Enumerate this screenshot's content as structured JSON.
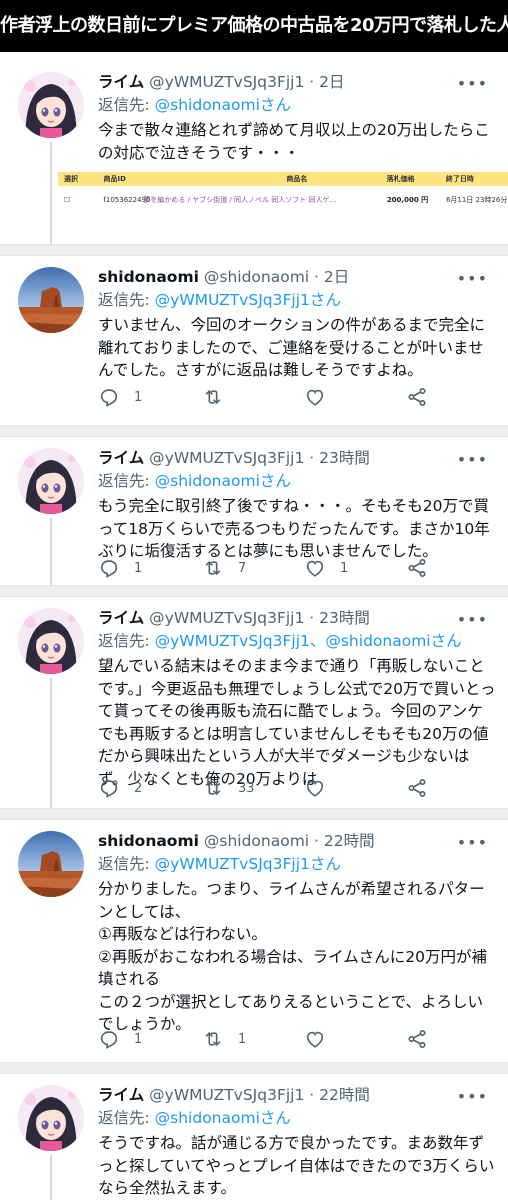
{
  "banner": "作者浮上の数日前にプレミア価格の中古品を20万円で落札した人",
  "reply_prefix": "返信先: ",
  "tweets": [
    {
      "name": "ライム",
      "handle": "@yWMUZTvSJq3Fjj1",
      "time": "2日",
      "reply_to": "@shidonaomi",
      "reply_suffix": "さん",
      "text": "今まで散々連絡とれず諦めて月収以上の20万出したらこの対応で泣きそうです・・・",
      "avatar": "anime-girl"
    },
    {
      "name": "shidonaomi",
      "handle": "@shidonaomi",
      "time": "2日",
      "reply_to": "@yWMUZTvSJq3Fjj1",
      "reply_suffix": "さん",
      "text": "すいません、今回のオークションの件があるまで完全に離れておりましたので、ご連絡を受けることが叶いませんでした。さすがに返品は難しそうですよね。",
      "avatar": "desert-rock",
      "replies": "1",
      "retweets": "",
      "likes": ""
    },
    {
      "name": "ライム",
      "handle": "@yWMUZTvSJq3Fjj1",
      "time": "23時間",
      "reply_to": "@shidonaomi",
      "reply_suffix": "さん",
      "text": "もう完全に取引終了後ですね・・・。そもそも20万で買って18万くらいで売るつもりだったんです。まさか10年ぶりに垢復活するとは夢にも思いませんでした。",
      "avatar": "anime-girl",
      "replies": "1",
      "retweets": "7",
      "likes": "1"
    },
    {
      "name": "ライム",
      "handle": "@yWMUZTvSJq3Fjj1",
      "time": "23時間",
      "reply_to": "@yWMUZTvSJq3Fjj1、@shidonaomi",
      "reply_suffix": "さん",
      "text": "望んでいる結末はそのまま今まで通り「再販しないことです。」今更返品も無理でしょうし公式で20万で買いとって貰ってその後再販も流石に酷でしょう。今回のアンケでも再販するとは明言していませんしそもそも20万の値だから興味出たという人が大半でダメージも少ないはず。少なくとも俺の20万よりは",
      "avatar": "anime-girl",
      "replies": "2",
      "retweets": "33",
      "likes": ""
    },
    {
      "name": "shidonaomi",
      "handle": "@shidonaomi",
      "time": "22時間",
      "reply_to": "@yWMUZTvSJq3Fjj1",
      "reply_suffix": "さん",
      "text": "分かりました。つまり、ライムさんが希望されるパターンとしては、\n①再販などは行わない。\n②再販がおこなわれる場合は、ライムさんに20万円が補填される\nこの２つが選択としてありえるということで、よろしいでしょうか。",
      "avatar": "desert-rock",
      "replies": "1",
      "retweets": "1",
      "likes": ""
    },
    {
      "name": "ライム",
      "handle": "@yWMUZTvSJq3Fjj1",
      "time": "22時間",
      "reply_to": "@shidonaomi",
      "reply_suffix": "さん",
      "text": "そうですね。話が通じる方で良かったです。まあ数年ずっと探していてやっとプレイ自体はできたので3万くらいなら全然払えます。",
      "avatar": "anime-girl"
    }
  ],
  "auction": {
    "headers": [
      "選択",
      "商品ID",
      "商品名",
      "落札価格",
      "終了日時"
    ],
    "id": "f1053622490",
    "title": "夢を編かめる / ヤブシ街道 / 同人ノベル 同人ソフト 同人ゲ...",
    "price": "200,000 円",
    "end": "6月11日 23時26分"
  },
  "colors": {
    "link": "#1d9bf0",
    "muted": "#536471",
    "table_header": "#fde47f",
    "like_red": "#f91880"
  },
  "icons": [
    "more-icon",
    "reply-icon",
    "retweet-icon",
    "like-icon",
    "share-icon"
  ]
}
